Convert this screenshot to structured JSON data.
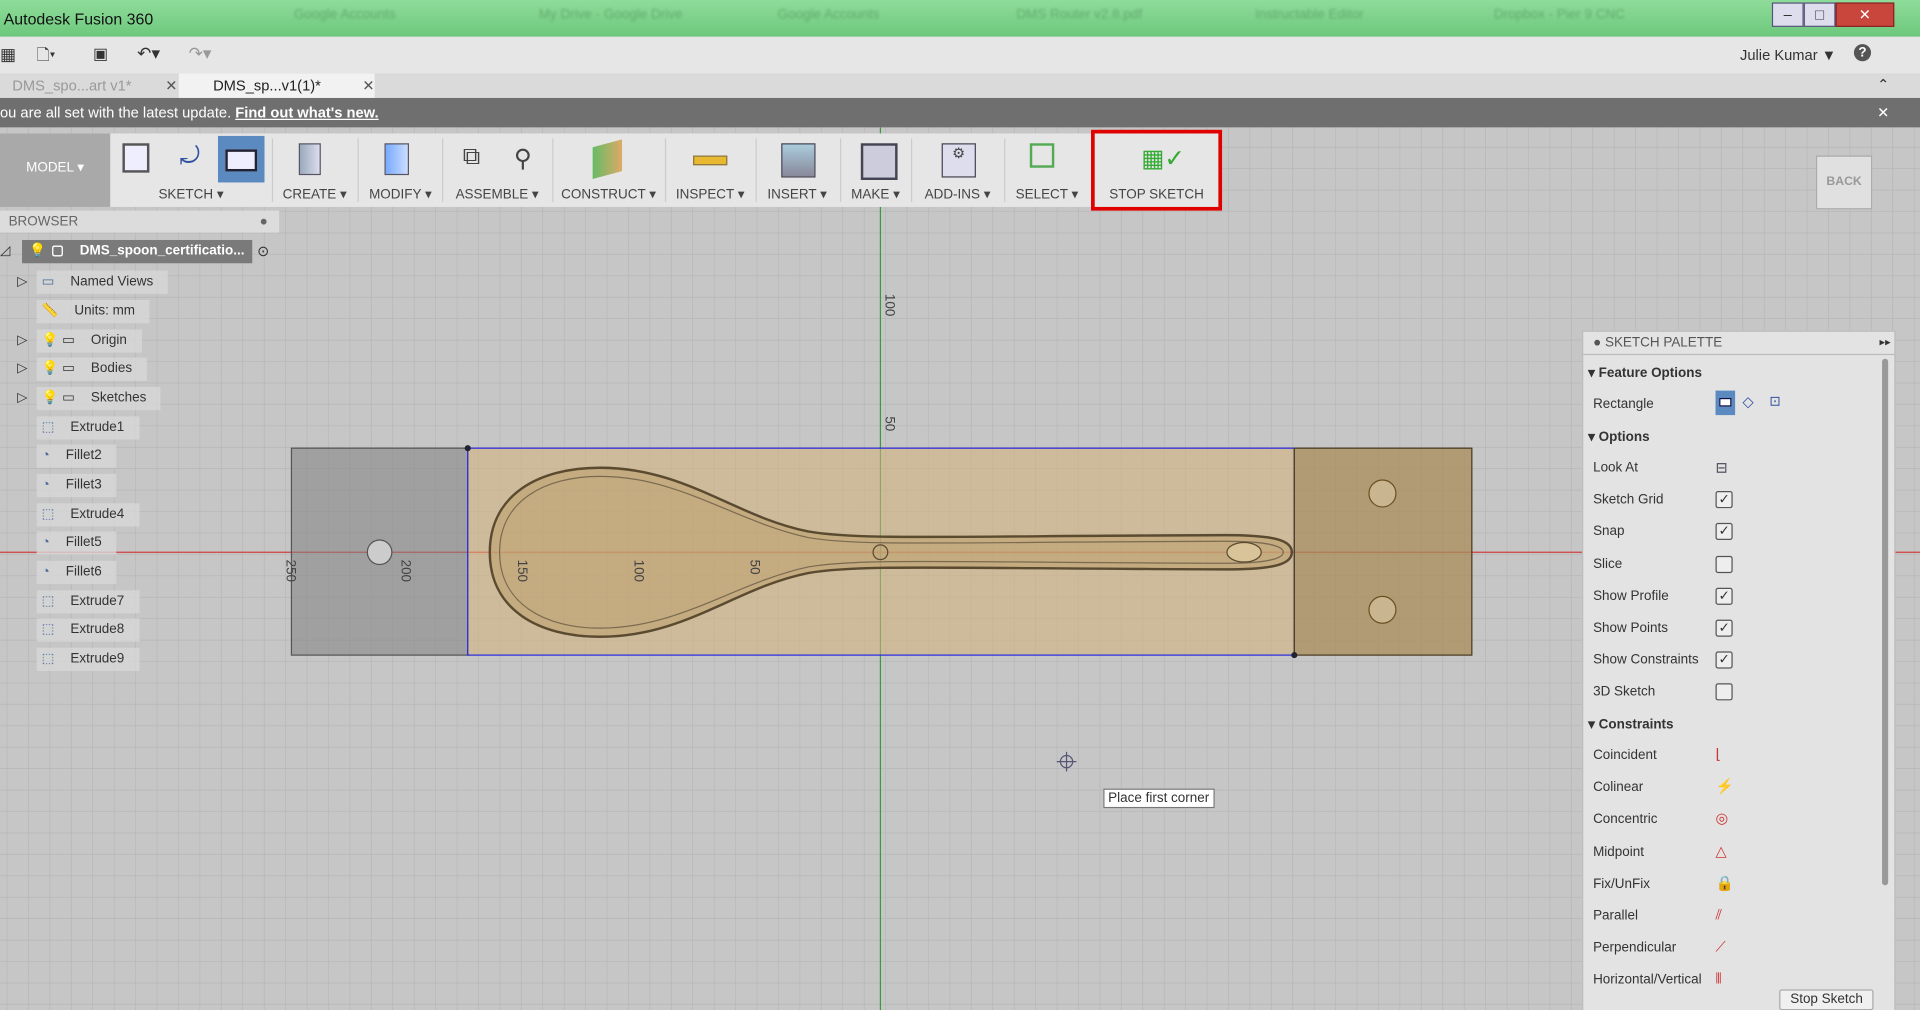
{
  "window": {
    "title": "Autodesk Fusion 360",
    "browser_tabs": [
      "Google Accounts",
      "My Drive - Google Drive",
      "Google Accounts",
      "DMS Router v2.8.pdf",
      "Instructable Editor",
      "Dropbox - Pier 9 CNC"
    ]
  },
  "quickbar": {
    "user": "Julie Kumar ▼",
    "help": "?"
  },
  "doc_tabs": [
    {
      "label": "DMS_spo...art v1*",
      "active": false
    },
    {
      "label": "DMS_sp...v1(1)*",
      "active": true
    }
  ],
  "notice": {
    "text": "ou are all set with the latest update.",
    "link": "Find out what's new."
  },
  "toolbar": {
    "workspace": "MODEL ▾",
    "groups": [
      "SKETCH ▾",
      "CREATE ▾",
      "MODIFY ▾",
      "ASSEMBLE ▾",
      "CONSTRUCT ▾",
      "INSPECT ▾",
      "INSERT ▾",
      "MAKE ▾",
      "ADD-INS ▾",
      "SELECT ▾",
      "STOP SKETCH"
    ],
    "highlight_color": "#e00000"
  },
  "viewcube": {
    "label": "BACK"
  },
  "browser": {
    "title": "BROWSER",
    "root": "DMS_spoon_certificatio...",
    "items": [
      "Named Views",
      "Units: mm",
      "Origin",
      "Bodies",
      "Sketches",
      "Extrude1",
      "Fillet2",
      "Fillet3",
      "Extrude4",
      "Fillet5",
      "Fillet6",
      "Extrude7",
      "Extrude8",
      "Extrude9"
    ]
  },
  "canvas": {
    "dims_h": [
      "250",
      "200",
      "150",
      "100",
      "50"
    ],
    "dims_v": [
      "100",
      "50"
    ],
    "tooltip": "Place first corner"
  },
  "palette": {
    "title": "SKETCH PALETTE",
    "feature_header": "Feature Options",
    "rect_label": "Rectangle",
    "options_header": "Options",
    "options": [
      {
        "label": "Look At",
        "type": "button"
      },
      {
        "label": "Sketch Grid",
        "checked": true
      },
      {
        "label": "Snap",
        "checked": true
      },
      {
        "label": "Slice",
        "checked": false
      },
      {
        "label": "Show Profile",
        "checked": true
      },
      {
        "label": "Show Points",
        "checked": true
      },
      {
        "label": "Show Constraints",
        "checked": true
      },
      {
        "label": "3D Sketch",
        "checked": false
      }
    ],
    "constraints_header": "Constraints",
    "constraints": [
      {
        "label": "Coincident",
        "icon": "coincident-icon"
      },
      {
        "label": "Colinear",
        "icon": "colinear-icon"
      },
      {
        "label": "Concentric",
        "icon": "concentric-icon"
      },
      {
        "label": "Midpoint",
        "icon": "midpoint-icon"
      },
      {
        "label": "Fix/UnFix",
        "icon": "lock-icon"
      },
      {
        "label": "Parallel",
        "icon": "parallel-icon"
      },
      {
        "label": "Perpendicular",
        "icon": "perpendicular-icon"
      },
      {
        "label": "Horizontal/Vertical",
        "icon": "horizontal-vertical-icon"
      }
    ],
    "stop_button": "Stop Sketch"
  }
}
